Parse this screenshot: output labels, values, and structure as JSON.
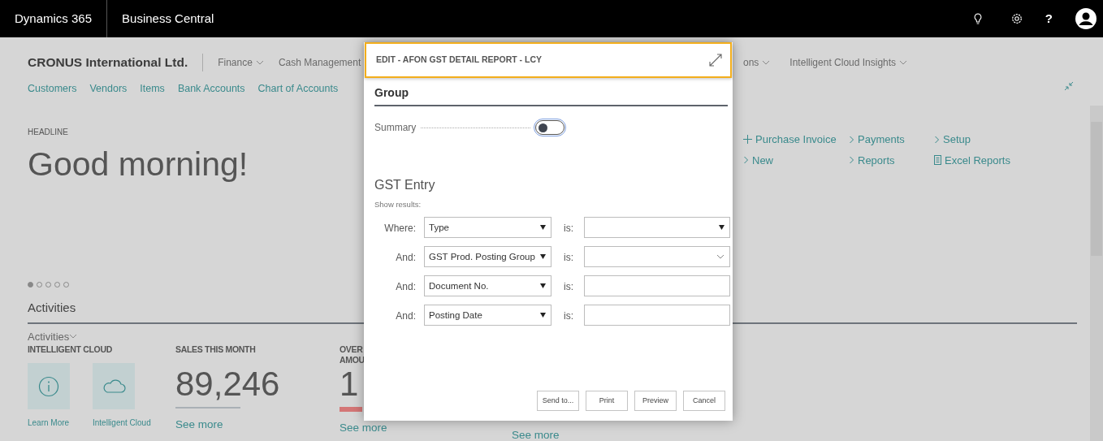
{
  "top_bar": {
    "product": "Dynamics 365",
    "app": "Business Central",
    "help": "?"
  },
  "page": {
    "company": "CRONUS International Ltd.",
    "menu_left": [
      {
        "label": "Finance",
        "dropdown": true
      },
      {
        "label": "Cash Management",
        "dropdown": false
      }
    ],
    "menu_right": [
      {
        "label": "ons",
        "dropdown": true
      },
      {
        "label": "Intelligent Cloud Insights",
        "dropdown": true
      }
    ],
    "quick_links": [
      "Customers",
      "Vendors",
      "Items",
      "Bank Accounts",
      "Chart of Accounts"
    ],
    "headline": {
      "caption": "HEADLINE",
      "text": "Good morning!",
      "dots": [
        {
          "selected": true
        },
        {
          "selected": false
        },
        {
          "selected": false
        },
        {
          "selected": false
        },
        {
          "selected": false
        }
      ]
    },
    "actions": [
      {
        "kind": "add",
        "label": "Purchase Invoice"
      },
      {
        "kind": "link",
        "label": "New"
      },
      {
        "kind": "link",
        "label": "Payments"
      },
      {
        "kind": "link",
        "label": "Reports"
      },
      {
        "kind": "link",
        "label": "Setup"
      },
      {
        "kind": "report",
        "label": "Excel Reports"
      }
    ],
    "activities": {
      "title": "Activities",
      "group": "Activities",
      "cues": [
        {
          "kind": "tiles",
          "title": [
            "INTELLIGENT CLOUD"
          ],
          "tiles": [
            {
              "label": "Learn More"
            },
            {
              "label": "Intelligent Cloud"
            }
          ]
        },
        {
          "kind": "number",
          "title": [
            "SALES THIS MONTH"
          ],
          "value": "89,246",
          "color": "#a9b0b5",
          "link": "See more"
        },
        {
          "kind": "number",
          "title": [
            "OVER",
            "AMOU"
          ],
          "value": "1",
          "color": "#d47676",
          "link": "See more"
        },
        {
          "kind": "link",
          "link": "See more"
        }
      ]
    }
  },
  "dialog": {
    "title": "EDIT - AFON GST DETAIL REPORT - LCY",
    "group_title": "Group",
    "options": [
      {
        "label": "Summary",
        "on": false
      }
    ],
    "filter_title": "GST Entry",
    "filter_caption": "Show results:",
    "filters": [
      {
        "kind": "dropdown",
        "connector": "Where:",
        "field": "Type",
        "operator": "is:"
      },
      {
        "kind": "lookup",
        "connector": "And:",
        "field": "GST Prod. Posting Group",
        "operator": "is:"
      },
      {
        "kind": "text",
        "connector": "And:",
        "field": "Document No.",
        "operator": "is:"
      },
      {
        "kind": "text",
        "connector": "And:",
        "field": "Posting Date",
        "operator": "is:"
      }
    ],
    "buttons": [
      "Send to...",
      "Print",
      "Preview",
      "Cancel"
    ]
  }
}
